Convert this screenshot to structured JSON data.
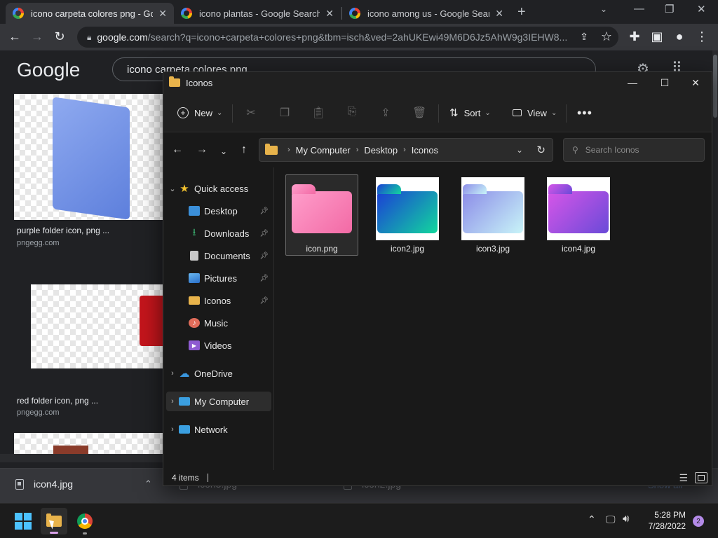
{
  "browser": {
    "tabs": [
      {
        "title": "icono carpeta colores png - Goo"
      },
      {
        "title": "icono plantas - Google Search"
      },
      {
        "title": "icono among us - Google Search"
      }
    ],
    "url_host": "google.com",
    "url_path": "/search?q=icono+carpeta+colores+png&tbm=isch&ved=2ahUKEwi49M6D6Jz5AhW9g3IEHW8...",
    "google_logo": "Google",
    "search_query": "icono carpeta colores png",
    "results": [
      {
        "title": "purple folder icon, png ...",
        "source": "pngegg.com"
      },
      {
        "title": "red folder icon, png ...",
        "source": "pngegg.com"
      }
    ],
    "downloads": [
      {
        "name": "icon4.jpg"
      },
      {
        "name": "icon3.jpg"
      },
      {
        "name": "icon2.jpg"
      }
    ],
    "download_show_all": "Show all"
  },
  "explorer": {
    "title": "Iconos",
    "commands": {
      "new": "New",
      "sort": "Sort",
      "view": "View"
    },
    "breadcrumb": [
      "My Computer",
      "Desktop",
      "Iconos"
    ],
    "search_placeholder": "Search Iconos",
    "sidebar": {
      "quick_access": "Quick access",
      "pinned": [
        {
          "label": "Desktop",
          "icon": "desktop-icon",
          "color": "#3b8fd9"
        },
        {
          "label": "Downloads",
          "icon": "download-icon",
          "color": "#3cb371"
        },
        {
          "label": "Documents",
          "icon": "document-icon",
          "color": "#c9c9c9"
        },
        {
          "label": "Pictures",
          "icon": "pictures-icon",
          "color": "#3b8fd9"
        },
        {
          "label": "Iconos",
          "icon": "folder-icon",
          "color": "#e8b34b"
        },
        {
          "label": "Music",
          "icon": "music-icon",
          "color": "#e06c5a"
        },
        {
          "label": "Videos",
          "icon": "videos-icon",
          "color": "#8e5bd1"
        }
      ],
      "onedrive": "OneDrive",
      "my_computer": "My Computer",
      "network": "Network"
    },
    "files": [
      {
        "name": "icon.png",
        "colors": [
          "#ff9ecb",
          "#f26aa5"
        ]
      },
      {
        "name": "icon2.jpg",
        "colors": [
          "#1b3fd6",
          "#12d79d"
        ]
      },
      {
        "name": "icon3.jpg",
        "colors": [
          "#8c8ce8",
          "#c8f4f8"
        ]
      },
      {
        "name": "icon4.jpg",
        "colors": [
          "#d656e8",
          "#6a4ad8"
        ]
      }
    ],
    "status": "4 items"
  },
  "taskbar": {
    "time": "5:28 PM",
    "date": "7/28/2022",
    "notification_count": "2"
  }
}
